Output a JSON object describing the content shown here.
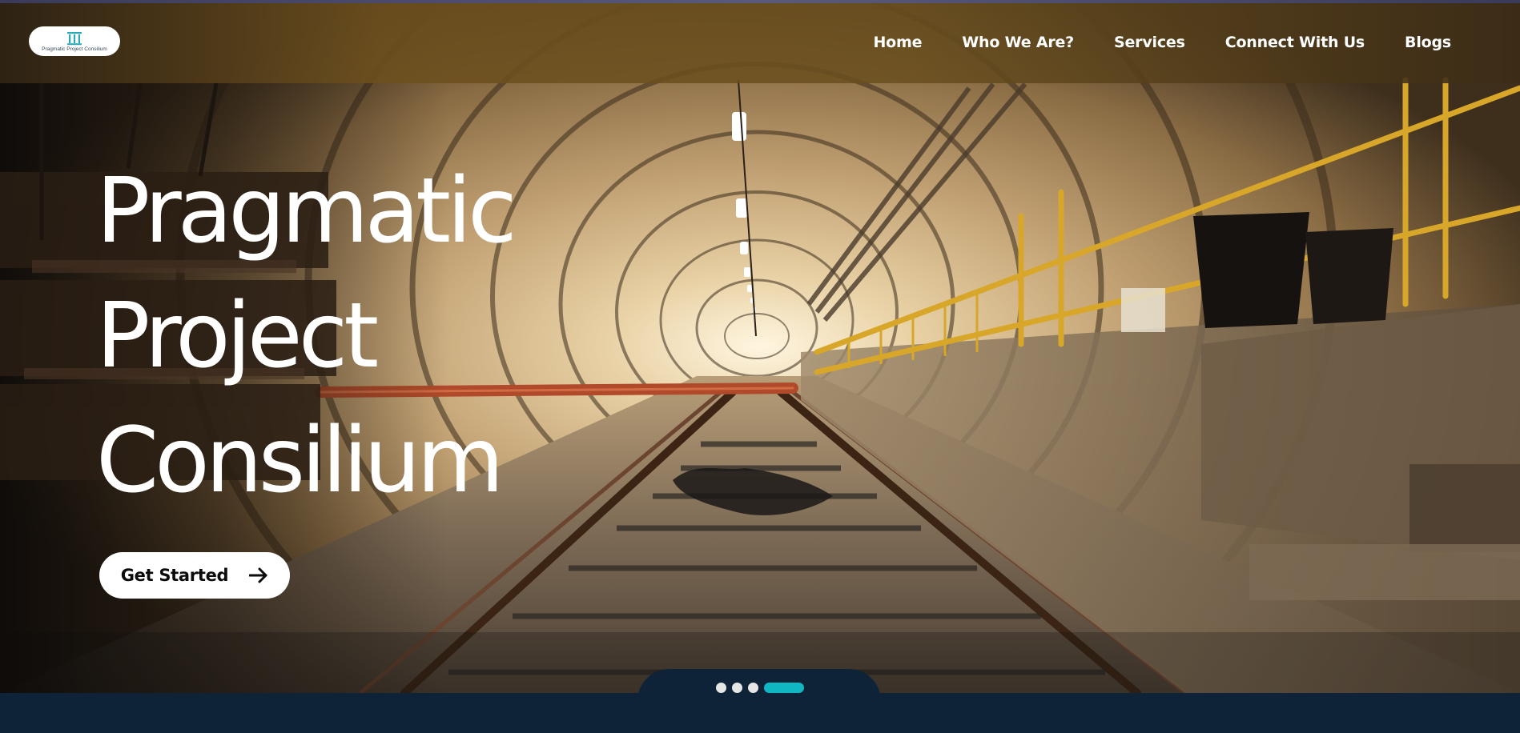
{
  "header": {
    "logo": {
      "text": "Pragmatic Project Consilium",
      "icon": "pillar-logo-icon",
      "accent": "#2aa8b5"
    },
    "nav": [
      {
        "label": "Home"
      },
      {
        "label": "Who We Are?"
      },
      {
        "label": "Services"
      },
      {
        "label": "Connect With Us"
      },
      {
        "label": "Blogs"
      }
    ]
  },
  "hero": {
    "title_lines": [
      "Pragmatic",
      "Project",
      "Consilium"
    ],
    "cta_label": "Get Started",
    "cta_icon": "arrow-right-icon",
    "background": "railway-tunnel-photo"
  },
  "slider": {
    "total": 4,
    "active_index": 3,
    "active_color": "#10b7c3",
    "dot_color": "#e6e6e6"
  },
  "theme": {
    "band_color": "#0e2238",
    "header_tint": "#6e501e",
    "text_color": "#ffffff"
  }
}
